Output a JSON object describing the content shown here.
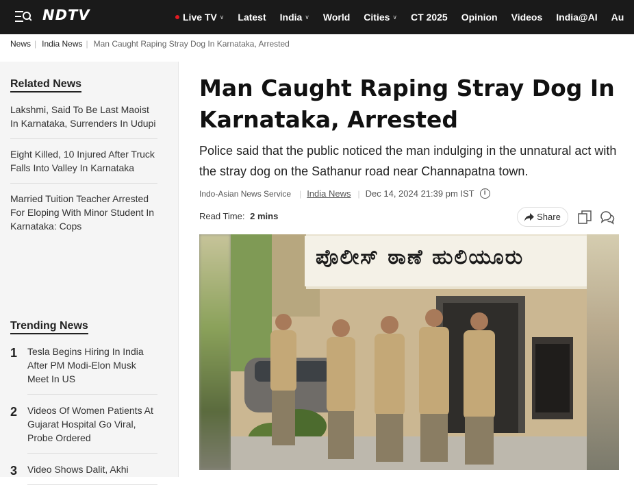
{
  "header": {
    "logo_text": "NDTV",
    "nav": [
      {
        "label": "Live TV",
        "live": true,
        "dropdown": true
      },
      {
        "label": "Latest",
        "live": false,
        "dropdown": false
      },
      {
        "label": "India",
        "live": false,
        "dropdown": true
      },
      {
        "label": "World",
        "live": false,
        "dropdown": false
      },
      {
        "label": "Cities",
        "live": false,
        "dropdown": true
      },
      {
        "label": "CT 2025",
        "live": false,
        "dropdown": false
      },
      {
        "label": "Opinion",
        "live": false,
        "dropdown": false
      },
      {
        "label": "Videos",
        "live": false,
        "dropdown": false
      },
      {
        "label": "India@AI",
        "live": false,
        "dropdown": false
      },
      {
        "label": "Au",
        "live": false,
        "dropdown": false
      }
    ],
    "accent_color": "#e21b22"
  },
  "breadcrumb": {
    "items": [
      "News",
      "India News"
    ],
    "current": "Man Caught Raping Stray Dog In Karnataka, Arrested"
  },
  "sidebar": {
    "related_title": "Related News",
    "related": [
      "Lakshmi, Said To Be Last Maoist In Karnataka, Surrenders In Udupi",
      "Eight Killed, 10 Injured After Truck Falls Into Valley In Karnataka",
      "Married Tuition Teacher Arrested For Eloping With Minor Student In Karnataka: Cops"
    ],
    "trending_title": "Trending News",
    "trending": [
      {
        "num": "1",
        "text": "Tesla Begins Hiring In India After PM Modi-Elon Musk Meet In US"
      },
      {
        "num": "2",
        "text": "Videos Of Women Patients At Gujarat Hospital Go Viral, Probe Ordered"
      },
      {
        "num": "3",
        "text": "Video Shows Dalit, Akhi"
      }
    ]
  },
  "article": {
    "headline": "Man Caught Raping Stray Dog In Karnataka, Arrested",
    "summary": "Police said that the public noticed the man indulging in the unnatural act with the stray dog on the Sathanur road near Channapatna town.",
    "author": "Indo-Asian News Service",
    "category": "India News",
    "date": "Dec 14, 2024 21:39 pm IST",
    "read_time_label": "Read Time:",
    "read_time_value": "2 mins",
    "share_label": "Share",
    "photo_sign_text": "ಪೊಲೀಸ್ ಠಾಣೆ ಹುಲಿಯೂರು"
  }
}
